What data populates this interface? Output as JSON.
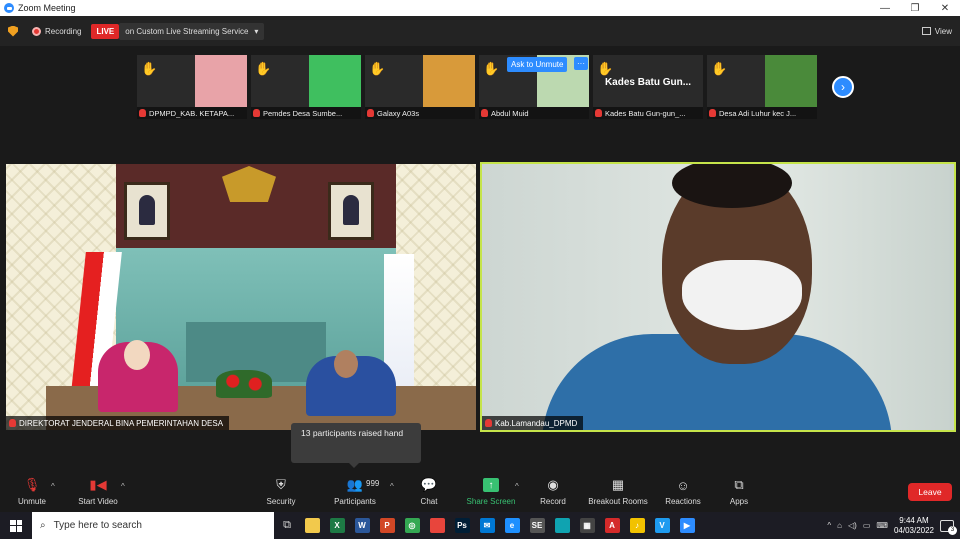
{
  "window": {
    "title": "Zoom Meeting",
    "controls": {
      "minimize": "—",
      "maximize": "❐",
      "close": "✕"
    }
  },
  "topbar": {
    "recording_label": "Recording",
    "live_badge": "LIVE",
    "stream_service": "on Custom Live Streaming Service",
    "view_label": "View"
  },
  "thumbnails": [
    {
      "name": "DPMPD_KAB. KETAPA...",
      "photo_color": "#e8a3a8"
    },
    {
      "name": "Pemdes Desa Sumbe...",
      "photo_color": "#3fbf5f"
    },
    {
      "name": "Galaxy A03s",
      "photo_color": "#d89a3a"
    },
    {
      "name": "Abdul Muid",
      "photo_color": "#bcd9b0"
    },
    {
      "name": "Kades Batu Gun-gun_...",
      "display_name": "Kades Batu Gun..."
    },
    {
      "name": "Desa Adi Luhur kec J...",
      "photo_color": "#4a8a3a"
    }
  ],
  "thumb_overlay": {
    "ask_unmute": "Ask to Unmute",
    "more": "···"
  },
  "main_videos": {
    "left_label": "DIREKTORAT JENDERAL BINA PEMERINTAHAN DESA",
    "right_label": "Kab.Lamandau_DPMD"
  },
  "tooltip": "13 participants raised hand",
  "controls": {
    "unmute": "Unmute",
    "start_video": "Start Video",
    "security": "Security",
    "participants": "Participants",
    "participants_count": "999",
    "chat": "Chat",
    "share_screen": "Share Screen",
    "record": "Record",
    "breakout_rooms": "Breakout Rooms",
    "reactions": "Reactions",
    "apps": "Apps",
    "leave": "Leave"
  },
  "taskbar": {
    "search_placeholder": "Type here to search",
    "apps": [
      {
        "name": "file-explorer",
        "label": "",
        "color": "#f2c94c"
      },
      {
        "name": "excel",
        "label": "X",
        "color": "#1d7a45"
      },
      {
        "name": "word",
        "label": "W",
        "color": "#2b579a"
      },
      {
        "name": "powerpoint",
        "label": "P",
        "color": "#d24726"
      },
      {
        "name": "tripadvisor",
        "label": "◎",
        "color": "#34a853"
      },
      {
        "name": "chrome",
        "label": "",
        "color": "#e8453c"
      },
      {
        "name": "photoshop",
        "label": "Ps",
        "color": "#001e36"
      },
      {
        "name": "mail",
        "label": "✉",
        "color": "#0078d4"
      },
      {
        "name": "edge-legacy",
        "label": "e",
        "color": "#1e90ff"
      },
      {
        "name": "se-app",
        "label": "SE",
        "color": "#555555"
      },
      {
        "name": "edge",
        "label": "",
        "color": "#0fa3b1"
      },
      {
        "name": "store",
        "label": "▦",
        "color": "#444444"
      },
      {
        "name": "acrobat",
        "label": "A",
        "color": "#d42a2a"
      },
      {
        "name": "karaoke",
        "label": "♪",
        "color": "#f2c200"
      },
      {
        "name": "vivaldi",
        "label": "V",
        "color": "#1e9bf0"
      },
      {
        "name": "zoom",
        "label": "▶",
        "color": "#2d8cff"
      }
    ],
    "time": "9:44 AM",
    "date": "04/03/2022",
    "notification_count": "3"
  }
}
